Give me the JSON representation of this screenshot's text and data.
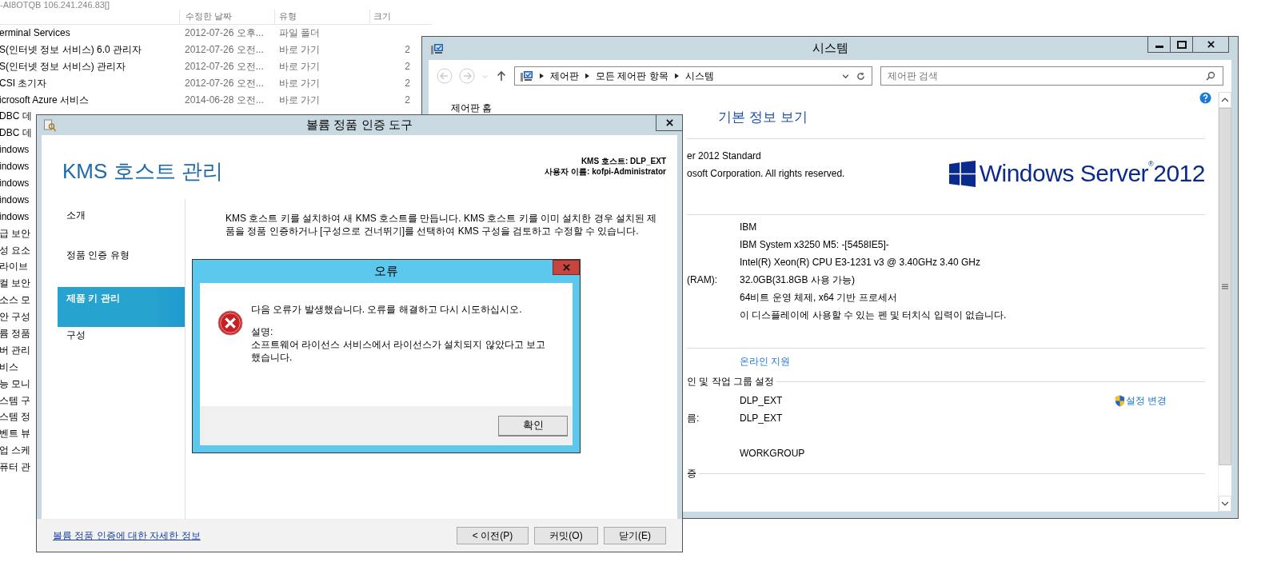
{
  "explorer": {
    "title": "-AI8OTQB 106.241.246.83[]",
    "columns": [
      "수정한 날짜",
      "유형",
      "크기"
    ],
    "rows": [
      {
        "name": "erminal Services",
        "date": "2012-07-26 오후...",
        "type": "파일 폴더"
      },
      {
        "name": "S(인터넷 정보 서비스) 6.0 관리자",
        "date": "2012-07-26 오전...",
        "type": "바로 가기",
        "size": "2"
      },
      {
        "name": "S(인터넷 정보 서비스) 관리자",
        "date": "2012-07-26 오전...",
        "type": "바로 가기",
        "size": "2"
      },
      {
        "name": "CSI 초기자",
        "date": "2012-07-26 오전...",
        "type": "바로 가기",
        "size": "2"
      },
      {
        "name": "icrosoft Azure 서비스",
        "date": "2014-06-28 오전...",
        "type": "바로 가기",
        "size": "2"
      },
      {
        "name": "DBC 데"
      },
      {
        "name": "DBC 데"
      },
      {
        "name": "indows"
      },
      {
        "name": "indows"
      },
      {
        "name": "indows"
      },
      {
        "name": "indows"
      },
      {
        "name": "indows"
      },
      {
        "name": "급 보안"
      },
      {
        "name": "성 요소"
      },
      {
        "name": "라이브"
      },
      {
        "name": "컬 보안"
      },
      {
        "name": "소스 모"
      },
      {
        "name": "안 구성"
      },
      {
        "name": "륨 정품"
      },
      {
        "name": "버 관리"
      },
      {
        "name": "비스"
      },
      {
        "name": "능 모니"
      },
      {
        "name": "스템 구"
      },
      {
        "name": "스템 정"
      },
      {
        "name": "벤트 뷰"
      },
      {
        "name": "업 스케"
      },
      {
        "name": "퓨터 관"
      }
    ]
  },
  "system_window": {
    "title": "시스템",
    "breadcrumbs": [
      "제어판",
      "모든 제어판 항목",
      "시스템"
    ],
    "search": {
      "placeholder": "제어판 검색"
    },
    "sidebar_link": "제어판 홈",
    "heading": "기본 정보 보기",
    "edition": [
      "er 2012 Standard",
      "osoft Corporation. All rights reserved."
    ],
    "logo": "Windows Server$^{®}$2012",
    "system_rows": [
      {
        "value": "IBM"
      },
      {
        "value": "IBM System x3250 M5: -[5458IE5]-"
      },
      {
        "value": "Intel(R) Xeon(R) CPU E3-1231 v3 @ 3.40GHz   3.40 GHz"
      },
      {
        "label": "(RAM):",
        "value": "32.0GB(31.8GB 사용 가능)"
      },
      {
        "value": "64비트 운영 체제, x64 기반 프로세서"
      },
      {
        "value": "이 디스플레이에 사용할 수 있는 펜 및 터치식 입력이 없습니다."
      }
    ],
    "support_link": "온라인 지원",
    "computer_section": {
      "title": "인 및 작업 그룹 설정",
      "action": "설정 변경",
      "rows": [
        {
          "value": "DLP_EXT"
        },
        {
          "label": "름:",
          "value": "DLP_EXT"
        },
        {
          "value": ""
        },
        {
          "value": "WORKGROUP"
        }
      ]
    },
    "activation_title": "증"
  },
  "kms_window": {
    "title": "볼륨 정품 인증 도구",
    "heading": "KMS 호스트 관리",
    "host_info": [
      "KMS 호스트: DLP_EXT",
      "사용자 이름: kofpi-Administrator"
    ],
    "nav": [
      {
        "label": "소개",
        "selected": false
      },
      {
        "label": "정품 인증 유형",
        "selected": false
      },
      {
        "label": "제품 키 관리",
        "selected": true
      },
      {
        "label": "구성",
        "selected": false
      }
    ],
    "description": "KMS 호스트 키를 설치하여 새 KMS 호스트를 만듭니다. KMS 호스트 키를 이미 설치한 경우 설치된 제품을 정품 인증하거나 [구성으로 건너뛰기]를 선택하여 KMS 구성을 검토하고 수정할 수 있습니다.",
    "more_info_link": "볼륨 정품 인증에 대한 자세한 정보",
    "buttons": [
      "< 이전(P)",
      "커밋(O)",
      "닫기(E)"
    ]
  },
  "error_dialog": {
    "title": "오류",
    "message": "다음 오류가 발생했습니다. 오류를 해결하고 다시 시도하십시오.",
    "detail_label": "설명:",
    "detail": "소프트웨어 라이선스 서비스에서 라이선스가 설치되지 않았다고 보고 했습니다.",
    "button": "확인"
  }
}
